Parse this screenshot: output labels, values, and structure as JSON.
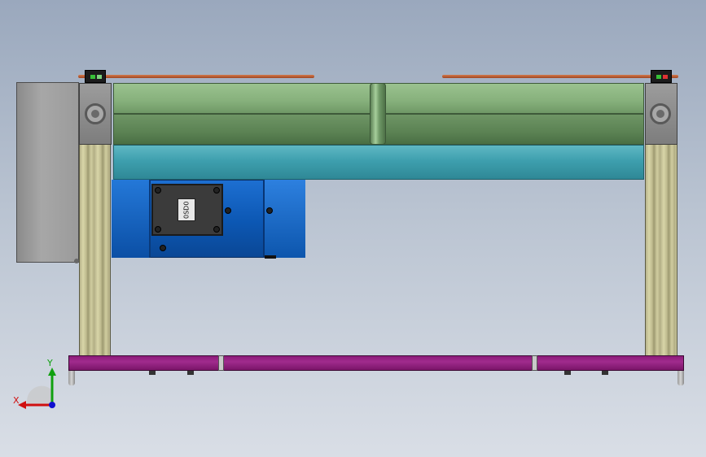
{
  "viewport": {
    "background_color": "#b9c3d1"
  },
  "model": {
    "gearbox_label": "0SD0"
  },
  "triad": {
    "x_label": "X",
    "y_label": "Y",
    "x_color": "#d01010",
    "y_color": "#10a010",
    "z_color": "#1010d0"
  },
  "colors": {
    "roller": "#86b07b",
    "belt": "#3e9fae",
    "motor": "#0c57b3",
    "base_frame": "#a02b8d",
    "rod": "#c0602f"
  }
}
